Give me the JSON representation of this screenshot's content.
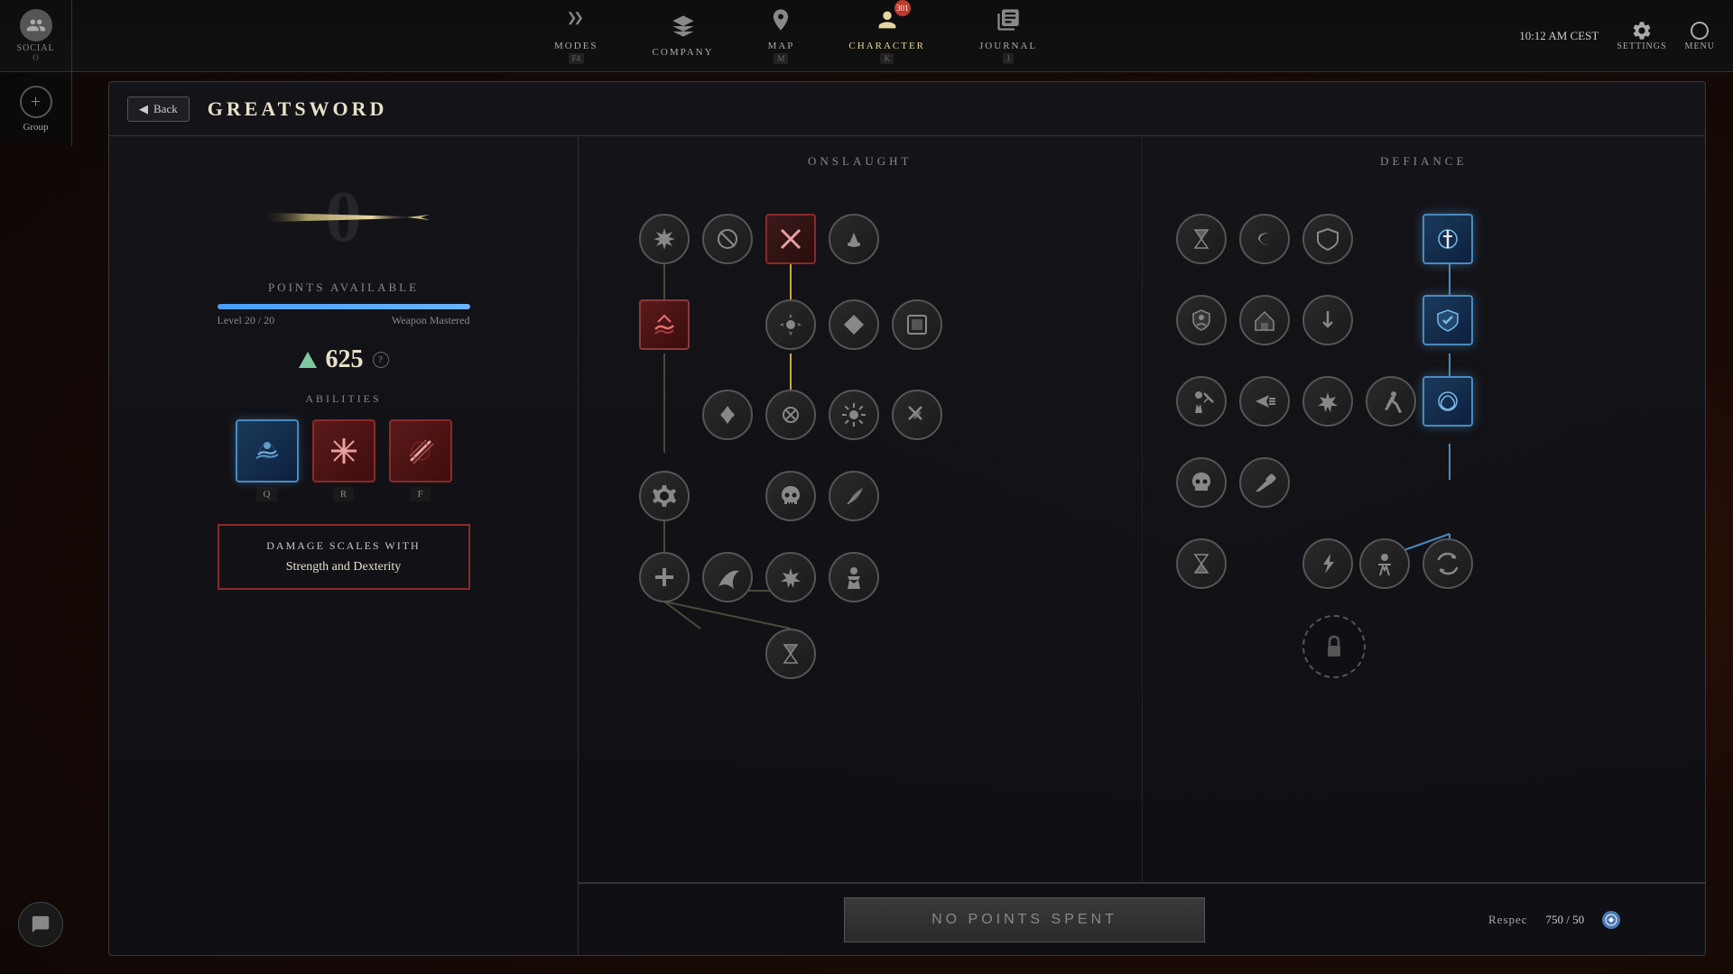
{
  "topbar": {
    "social_label": "SOCIAL",
    "social_key": "O",
    "time": "10:12 AM CEST",
    "nav": [
      {
        "id": "modes",
        "label": "MODES",
        "key": "F4",
        "active": false,
        "icon": "⚔"
      },
      {
        "id": "company",
        "label": "COMPANY",
        "key": "",
        "active": false,
        "icon": "🏴"
      },
      {
        "id": "map",
        "label": "MAP",
        "key": "M",
        "active": false,
        "icon": "🗺"
      },
      {
        "id": "character",
        "label": "CHARACTER",
        "key": "K",
        "active": true,
        "icon": "👤",
        "badge": "301"
      },
      {
        "id": "journal",
        "label": "JOURNAL",
        "key": "J",
        "active": false,
        "icon": "📖"
      }
    ],
    "settings_label": "SETTINGS",
    "menu_label": "MENU"
  },
  "panel": {
    "back_label": "Back",
    "title": "GREATSWORD",
    "points_available": "0",
    "points_label": "POINTS AVAILABLE",
    "level_current": "20",
    "level_max": "20",
    "level_label": "Level",
    "mastery_label": "Weapon Mastered",
    "score_value": "625",
    "score_help": "?",
    "abilities_title": "ABILITIES",
    "abilities": [
      {
        "key": "Q",
        "icon": "💧",
        "type": "blue"
      },
      {
        "key": "R",
        "icon": "✦",
        "type": "red"
      },
      {
        "key": "F",
        "icon": "⟋",
        "type": "red"
      }
    ],
    "damage_scales_title": "DAMAGE SCALES WITH",
    "damage_scales_value": "Strength and Dexterity"
  },
  "skill_tree": {
    "onslaught_title": "ONSLAUGHT",
    "defiance_title": "DEFIANCE",
    "no_points_label": "NO POINTS SPENT",
    "respec_label": "Respec",
    "respec_value": "750 / 50"
  }
}
